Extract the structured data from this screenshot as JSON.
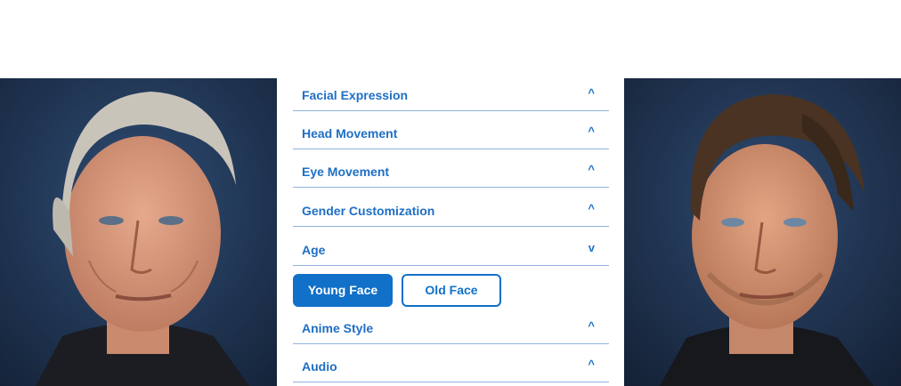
{
  "portraits": {
    "left": {
      "icon": "aged-face-portrait"
    },
    "right": {
      "icon": "original-face-portrait"
    }
  },
  "panel": {
    "rows": [
      {
        "label": "Facial Expression",
        "chevron": "^"
      },
      {
        "label": "Head Movement",
        "chevron": "^"
      },
      {
        "label": "Eye Movement",
        "chevron": "^"
      },
      {
        "label": "Gender Customization",
        "chevron": "^"
      },
      {
        "label": "Age",
        "chevron": "v"
      },
      {
        "label": "Anime Style",
        "chevron": "^"
      },
      {
        "label": "Audio",
        "chevron": "^"
      }
    ],
    "age_buttons": {
      "young_label": "Young Face",
      "old_label": "Old Face",
      "selected": "Young Face"
    }
  },
  "colors": {
    "accent": "#1170c8",
    "label": "#1f6fc4",
    "divider": "#8fb3df"
  }
}
